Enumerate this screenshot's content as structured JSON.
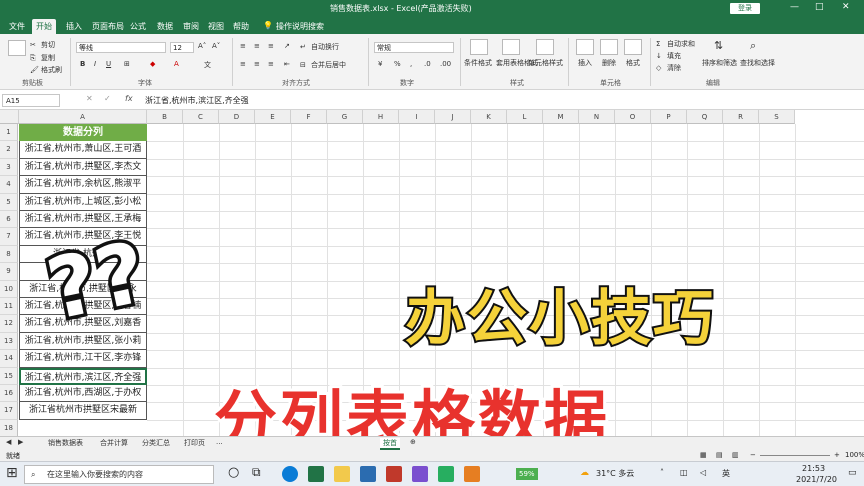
{
  "window": {
    "title": "销售数据表.xlsx - Excel(产品激活失败)",
    "login": "登录"
  },
  "tabs": [
    "文件",
    "开始",
    "插入",
    "页面布局",
    "公式",
    "数据",
    "审阅",
    "视图",
    "帮助",
    "操作说明搜索"
  ],
  "active_tab": "开始",
  "ribbon": {
    "clipboard": {
      "cut": "剪切",
      "copy": "复制",
      "format_painter": "格式刷",
      "group": "剪贴板"
    },
    "font": {
      "name": "等线",
      "size": "12",
      "group": "字体"
    },
    "alignment": {
      "wrap": "自动换行",
      "merge": "合并后居中",
      "group": "对齐方式"
    },
    "number": {
      "format": "常规",
      "group": "数字"
    },
    "styles": {
      "conditional": "条件格式",
      "table": "套用表格格式",
      "cell": "单元格样式",
      "group": "样式"
    },
    "cells": {
      "insert": "插入",
      "delete": "删除",
      "format": "格式",
      "group": "单元格"
    },
    "editing": {
      "autosum": "自动求和",
      "fill": "填充",
      "clear": "清除",
      "sort": "排序和筛选",
      "find": "查找和选择",
      "group": "编辑"
    }
  },
  "formula_bar": {
    "cell": "A15",
    "fx": "fx",
    "content": "浙江省,杭州市,滨江区,齐全强"
  },
  "columns": [
    "A",
    "B",
    "C",
    "D",
    "E",
    "F",
    "G",
    "H",
    "I",
    "J",
    "K",
    "L",
    "M",
    "N",
    "O",
    "P",
    "Q",
    "R",
    "S"
  ],
  "rows": [
    "1",
    "2",
    "3",
    "4",
    "5",
    "6",
    "7",
    "8",
    "9",
    "10",
    "11",
    "12",
    "13",
    "14",
    "15",
    "16",
    "17",
    "18"
  ],
  "header_cell": "数据分列",
  "cells": [
    "浙江省,杭州市,萧山区,王可酒",
    "浙江省,杭州市,拱墅区,李杰文",
    "浙江省,杭州市,余杭区,熊淑平",
    "浙江省,杭州市,上城区,彭小松",
    "浙江省,杭州市,拱墅区,王承梅",
    "浙江省,杭州市,拱墅区,李王悦",
    "浙江省,杭州市,",
    "",
    "浙江省,杭州市,拱墅区,蔡永",
    "浙江省,杭州市,拱墅区,刘睿楠",
    "浙江省,杭州市,拱墅区,刘嘉香",
    "浙江省,杭州市,拱墅区,张小莉",
    "浙江省,杭州市,江干区,李亦锋",
    "浙江省,杭州市,滨江区,齐全强",
    "浙江省,杭州市,西湖区,于办权",
    "浙江省杭州市拱墅区宋最新"
  ],
  "sheet_tabs": [
    "销售数据表",
    "合并计算",
    "分类汇总",
    "打印页",
    "...",
    "按首"
  ],
  "status": {
    "ready": "就绪",
    "zoom": "100%"
  },
  "taskbar": {
    "search_placeholder": "在这里输入你要搜索的内容",
    "weather": "31°C 多云",
    "time": "21:53",
    "date": "2021/7/20",
    "lang": "英",
    "battery": "59%"
  },
  "overlay": {
    "title_line1": "办公小技巧",
    "title_line2": "分列表格数据",
    "marks": "??"
  },
  "colors": {
    "excel_green": "#217346",
    "header_green": "#70ad47",
    "overlay_yellow": "#f5d23a",
    "overlay_red": "#e8322d"
  }
}
